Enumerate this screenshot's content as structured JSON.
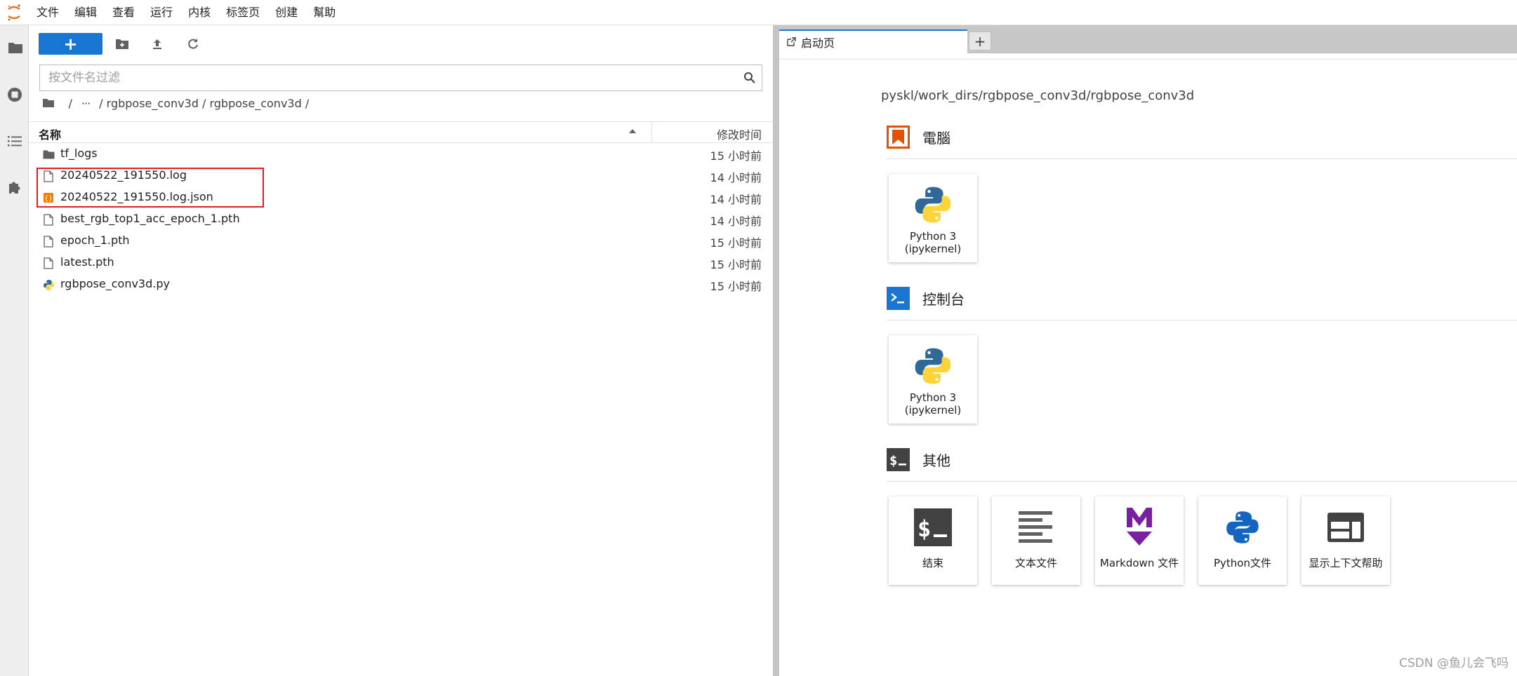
{
  "menubar": {
    "items": [
      "文件",
      "编辑",
      "查看",
      "运行",
      "内核",
      "标签页",
      "创建",
      "幫助"
    ]
  },
  "icons": {
    "logo": "jupyter-logo",
    "activity": [
      "folder-icon",
      "running-icon",
      "toc-icon",
      "extension-icon"
    ],
    "toolbar": [
      "plus-icon",
      "new-folder-icon",
      "upload-icon",
      "refresh-icon"
    ]
  },
  "filebrowser": {
    "new_label": "+",
    "filter_placeholder": "按文件名过滤",
    "filter_value": "",
    "breadcrumbs": {
      "sep1": "/",
      "ellipsis": "···",
      "path": "/ rgbpose_conv3d / rgbpose_conv3d /"
    },
    "columns": {
      "name": "名称",
      "modified": "修改时间"
    },
    "files": [
      {
        "name": "tf_logs",
        "type": "folder",
        "modified": "15 小时前"
      },
      {
        "name": "20240522_191550.log",
        "type": "file",
        "modified": "14 小时前"
      },
      {
        "name": "20240522_191550.log.json",
        "type": "json",
        "modified": "14 小时前"
      },
      {
        "name": "best_rgb_top1_acc_epoch_1.pth",
        "type": "file",
        "modified": "14 小时前"
      },
      {
        "name": "epoch_1.pth",
        "type": "file",
        "modified": "15 小时前"
      },
      {
        "name": "latest.pth",
        "type": "file",
        "modified": "15 小时前"
      },
      {
        "name": "rgbpose_conv3d.py",
        "type": "python",
        "modified": "15 小时前"
      }
    ]
  },
  "tabs": {
    "active_label": "启动页",
    "add_label": "+"
  },
  "launcher": {
    "cwd": "pyskl/work_dirs/rgbpose_conv3d/rgbpose_conv3d",
    "sections": {
      "notebook": {
        "title": "電腦",
        "cards": [
          {
            "label": "Python 3\n(ipykernel)"
          }
        ]
      },
      "console": {
        "title": "控制台",
        "cards": [
          {
            "label": "Python 3\n(ipykernel)"
          }
        ]
      },
      "other": {
        "title": "其他",
        "cards": [
          {
            "label": "结束"
          },
          {
            "label": "文本文件"
          },
          {
            "label": "Markdown 文件"
          },
          {
            "label": "Python文件"
          },
          {
            "label": "显示上下文帮助"
          }
        ]
      }
    }
  },
  "watermark": "CSDN @鱼儿会飞吗",
  "colors": {
    "accent": "#1976d2",
    "highlight_border": "#e0201e",
    "notebook_icon": "#e65100",
    "markdown_icon": "#7b1fa2",
    "python_blue": "#306998",
    "python_yellow": "#ffd43b"
  }
}
